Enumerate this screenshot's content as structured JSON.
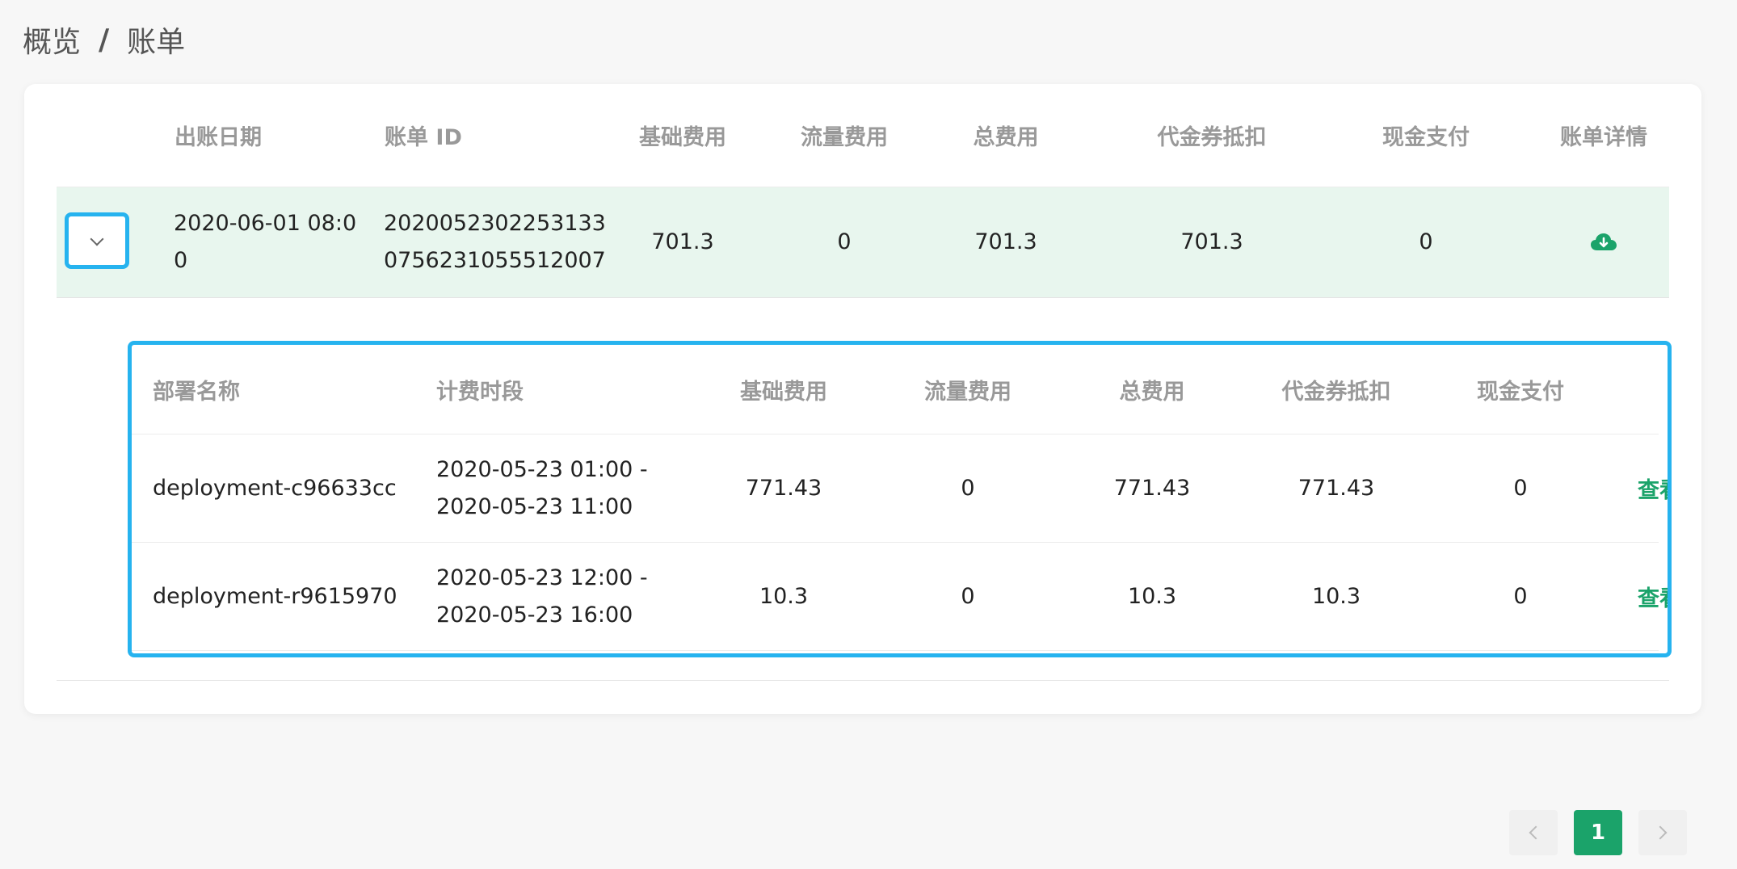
{
  "breadcrumb": {
    "items": [
      "概览",
      "账单"
    ],
    "separator": "/"
  },
  "outer_table": {
    "headers": [
      "出账日期",
      "账单 ID",
      "基础费用",
      "流量费用",
      "总费用",
      "代金券抵扣",
      "现金支付",
      "账单详情"
    ],
    "rows": [
      {
        "date_line1": "2020-06-01 08:0",
        "date_line2": "0",
        "id_line1": "2020052302253133",
        "id_line2": "0756231055512007",
        "base_fee": "701.3",
        "traffic_fee": "0",
        "total_fee": "701.3",
        "voucher": "701.3",
        "cash": "0",
        "detail_icon": "cloud-download-icon"
      }
    ]
  },
  "inner_table": {
    "headers": [
      "部署名称",
      "计费时段",
      "基础费用",
      "流量费用",
      "总费用",
      "代金券抵扣",
      "现金支付"
    ],
    "rows": [
      {
        "name": "deployment-c96633cc",
        "period_line1": "2020-05-23 01:00 -",
        "period_line2": "2020-05-23 11:00",
        "base_fee": "771.43",
        "traffic_fee": "0",
        "total_fee": "771.43",
        "voucher": "771.43",
        "cash": "0",
        "action": "查看"
      },
      {
        "name": "deployment-r9615970",
        "period_line1": "2020-05-23 12:00 -",
        "period_line2": "2020-05-23 16:00",
        "base_fee": "10.3",
        "traffic_fee": "0",
        "total_fee": "10.3",
        "voucher": "10.3",
        "cash": "0",
        "action": "查看"
      }
    ]
  },
  "pagination": {
    "current": "1"
  },
  "colors": {
    "accent": "#1ba36a",
    "highlight_border": "#26b3ef",
    "row_highlight": "#e8f6ee"
  }
}
